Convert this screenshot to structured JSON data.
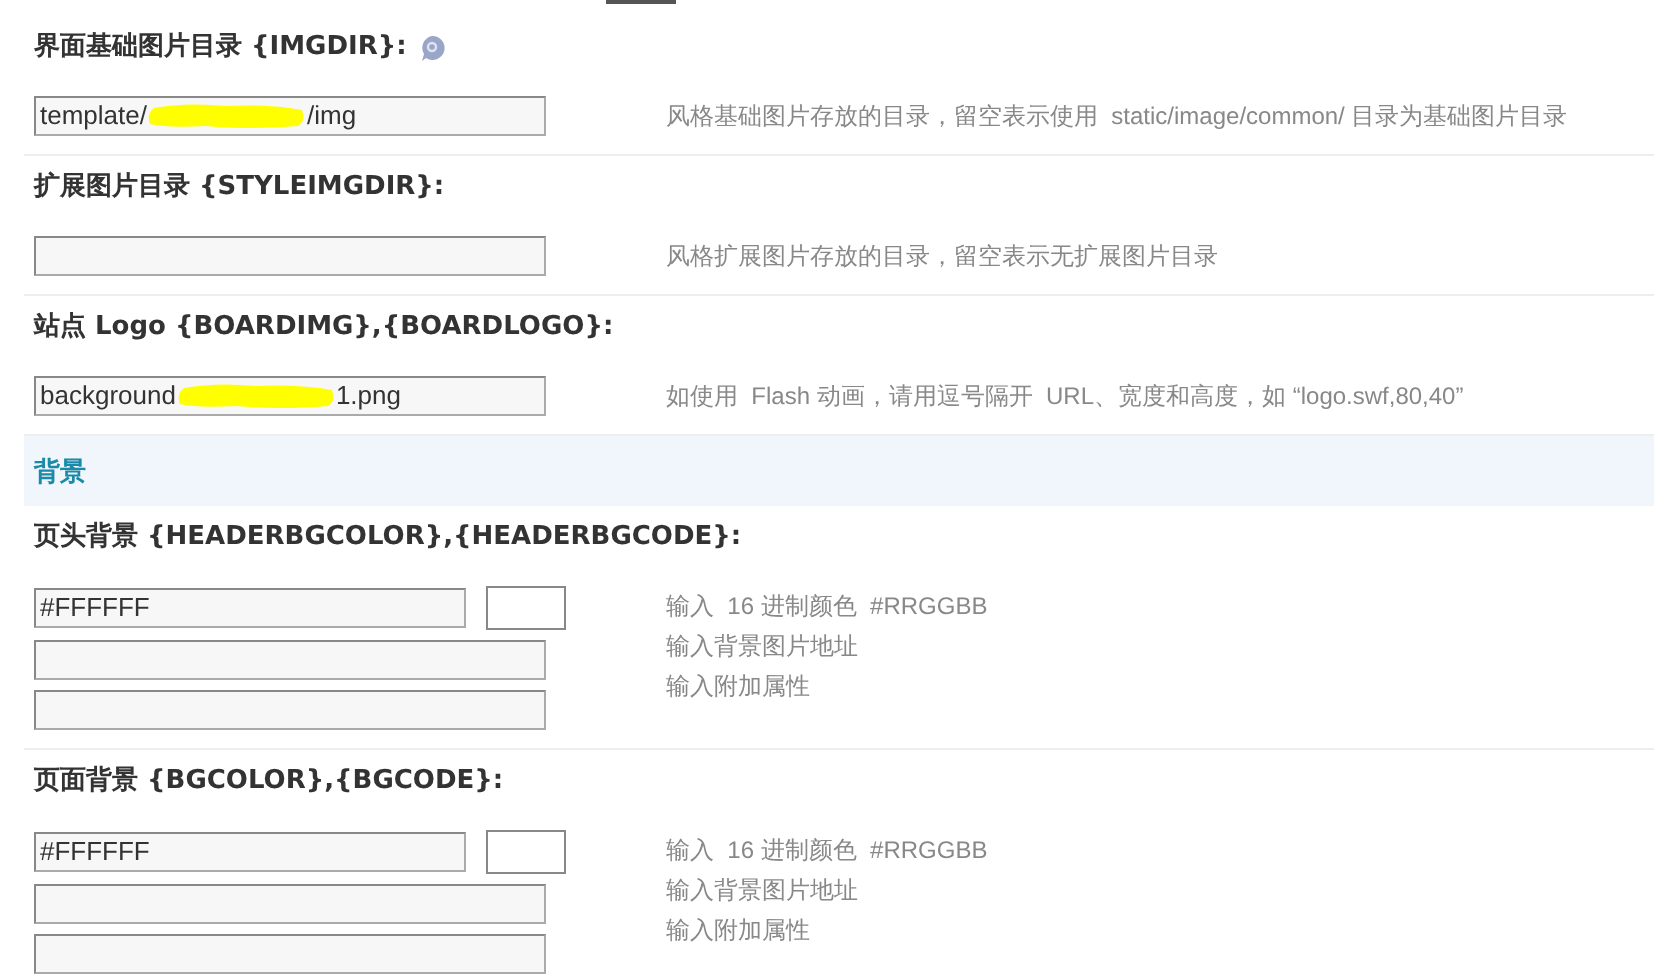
{
  "rows": [
    {
      "label": "界面基础图片目录 {IMGDIR}:",
      "help_icon": true,
      "fields": [
        {
          "kind": "text",
          "value": [
            "template/",
            "/img"
          ],
          "redacted": true
        }
      ],
      "descriptions": [
        "风格基础图片存放的目录，留空表示使用  static/image/common/ 目录为基础图片目录"
      ]
    },
    {
      "label": "扩展图片目录 {STYLEIMGDIR}:",
      "fields": [
        {
          "kind": "text"
        }
      ],
      "descriptions": [
        "风格扩展图片存放的目录，留空表示无扩展图片目录"
      ]
    },
    {
      "label": "站点 Logo {BOARDIMG},{BOARDLOGO}:",
      "fields": [
        {
          "kind": "text",
          "value": [
            "background",
            "1.png"
          ],
          "redacted": true
        }
      ],
      "descriptions": [
        "如使用  Flash 动画，请用逗号隔开  URL、宽度和高度，如 “logo.swf,80,40”"
      ]
    },
    {
      "kind": "section",
      "label": "背景"
    },
    {
      "label": "页头背景 {HEADERBGCOLOR},{HEADERBGCODE}:",
      "fields": [
        {
          "kind": "color",
          "value": [
            "#FFFFFF"
          ]
        },
        {
          "kind": "text"
        },
        {
          "kind": "text"
        }
      ],
      "descriptions": [
        "输入  16 进制颜色  #RRGGBB",
        "输入背景图片地址",
        "输入附加属性"
      ]
    },
    {
      "label": "页面背景 {BGCOLOR},{BGCODE}:",
      "fields": [
        {
          "kind": "color",
          "value": [
            "#FFFFFF"
          ]
        },
        {
          "kind": "text"
        },
        {
          "kind": "text"
        }
      ],
      "descriptions": [
        "输入  16 进制颜色  #RRGGBB",
        "输入背景图片地址",
        "输入附加属性"
      ]
    }
  ]
}
